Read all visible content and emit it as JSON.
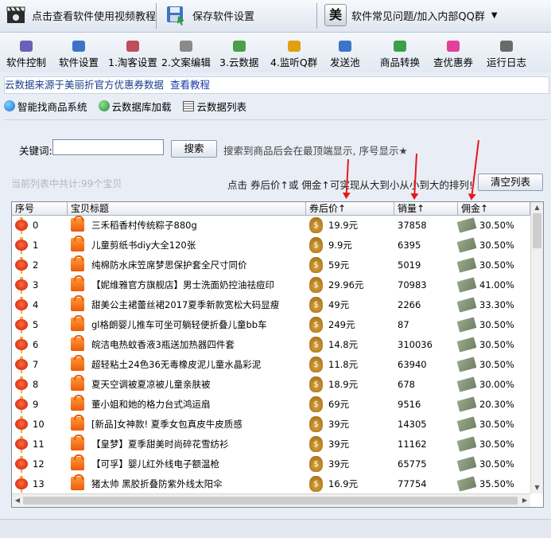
{
  "top_toolbar": {
    "video_tutorial": "点击查看软件使用视频教程",
    "save_settings": "保存软件设置",
    "faq_logo": "美",
    "faq_group": "软件常见问题/加入内部QQ群"
  },
  "nav": [
    {
      "label": "软件控制",
      "icon": "play-icon",
      "color": "#6b5fb8"
    },
    {
      "label": "软件设置",
      "icon": "gear-icon",
      "color": "#3b74c8"
    },
    {
      "label": "1.淘客设置",
      "icon": "pencil-icon",
      "color": "#c04d5a"
    },
    {
      "label": "2.文案编辑",
      "icon": "document-icon",
      "color": "#8a8a8a"
    },
    {
      "label": "3.云数据",
      "icon": "cloud-data-icon",
      "color": "#4aa04a"
    },
    {
      "label": "4.监听Q群",
      "icon": "qq-penguin-icon",
      "color": "#e0a010"
    },
    {
      "label": "发送池",
      "icon": "send-icon",
      "color": "#3b74c8"
    },
    {
      "label": "商品转换",
      "icon": "refresh-icon",
      "color": "#3aa04a"
    },
    {
      "label": "查优惠券",
      "icon": "coupon-icon",
      "color": "#e0409a"
    },
    {
      "label": "运行日志",
      "icon": "log-icon",
      "color": "#6a6a6a"
    }
  ],
  "info_bar": {
    "text": "云数据来源于美丽折官方优惠券数据",
    "link": "查看教程"
  },
  "tabs": [
    {
      "label": "智能找商品系统",
      "icon": "globe-icon"
    },
    {
      "label": "云数据库加载",
      "icon": "globe-icon"
    },
    {
      "label": "云数据列表",
      "icon": "list-icon"
    }
  ],
  "search": {
    "label": "关键词:",
    "value": "",
    "button": "搜索",
    "hint": "搜索到商品后会在最顶端显示, 序号显示★"
  },
  "list_count": "当前列表中共计:99个宝贝",
  "sort_hint": "点击 券后价↑或 佣金↑可实现从大到小从小到大的排列!",
  "clear_button": "清空列表",
  "columns": {
    "index": "序号",
    "title": "宝贝标题",
    "price": "券后价↑",
    "sales": "销量↑",
    "commission": "佣金↑"
  },
  "rows": [
    {
      "index": "0",
      "title": "三禾稻香村传统粽子880g",
      "price": "19.9元",
      "sales": "37858",
      "commission": "30.50%"
    },
    {
      "index": "1",
      "title": "儿童剪纸书diy大全120张",
      "price": "9.9元",
      "sales": "6395",
      "commission": "30.50%"
    },
    {
      "index": "2",
      "title": "纯棉防水床笠席梦思保护套全尺寸同价",
      "price": "59元",
      "sales": "5019",
      "commission": "30.50%"
    },
    {
      "index": "3",
      "title": "【妮维雅官方旗舰店】男士洗面奶控油祛痘印",
      "price": "29.96元",
      "sales": "70983",
      "commission": "41.00%"
    },
    {
      "index": "4",
      "title": "甜美公主裙蕾丝裙2017夏季新款宽松大码显瘦",
      "price": "49元",
      "sales": "2266",
      "commission": "33.30%"
    },
    {
      "index": "5",
      "title": "gl格朗婴儿推车可坐可躺轻便折叠儿童bb车",
      "price": "249元",
      "sales": "87",
      "commission": "30.50%"
    },
    {
      "index": "6",
      "title": "皖洁电热蚊香液3瓶送加热器四件套",
      "price": "14.8元",
      "sales": "310036",
      "commission": "30.50%"
    },
    {
      "index": "7",
      "title": "超轻粘土24色36无毒橡皮泥儿童水晶彩泥",
      "price": "11.8元",
      "sales": "63940",
      "commission": "30.50%"
    },
    {
      "index": "8",
      "title": "夏天空调被夏凉被儿童亲肤被",
      "price": "18.9元",
      "sales": "678",
      "commission": "30.00%"
    },
    {
      "index": "9",
      "title": "董小姐和她的格力台式鸿运扇",
      "price": "69元",
      "sales": "9516",
      "commission": "20.30%"
    },
    {
      "index": "10",
      "title": "[新品]女神款! 夏季女包真皮牛皮质感",
      "price": "39元",
      "sales": "14305",
      "commission": "30.50%"
    },
    {
      "index": "11",
      "title": "【皇梦】夏季甜美时尚碎花雪纺衫",
      "price": "39元",
      "sales": "11162",
      "commission": "30.50%"
    },
    {
      "index": "12",
      "title": "【可孚】婴儿红外线电子额温枪",
      "price": "39元",
      "sales": "65775",
      "commission": "30.50%"
    },
    {
      "index": "13",
      "title": "猪太帅 黑胶折叠防紫外线太阳伞",
      "price": "16.9元",
      "sales": "77754",
      "commission": "35.50%"
    }
  ]
}
